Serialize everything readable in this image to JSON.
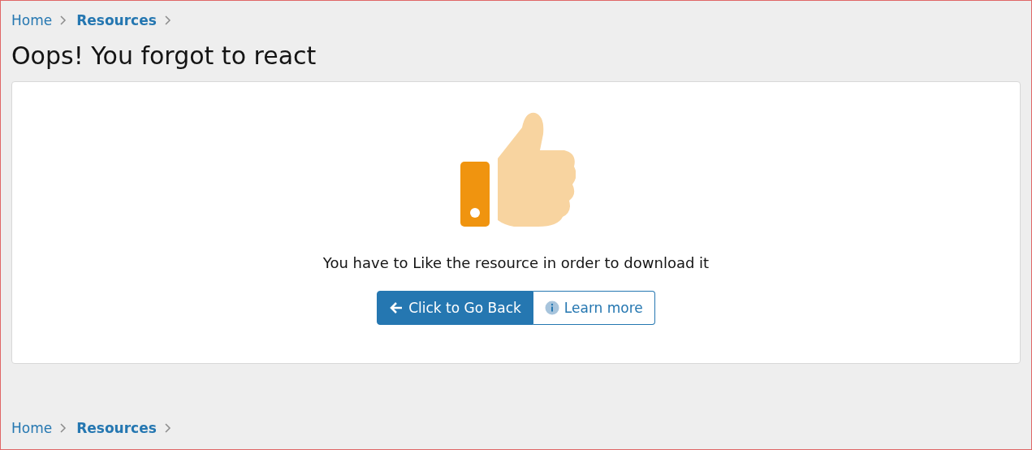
{
  "breadcrumb_top": [
    {
      "label": "Home",
      "bold": false
    },
    {
      "label": "Resources",
      "bold": true
    }
  ],
  "title": "Oops! You forgot to react",
  "notice": {
    "message": "You have to Like the resource in order to download it",
    "buttons": [
      {
        "label": "Click to Go Back",
        "kind": "primary"
      },
      {
        "label": "Learn more",
        "kind": "secondary"
      }
    ]
  },
  "breadcrumb_bottom": [
    {
      "label": "Home",
      "bold": false
    },
    {
      "label": "Resources",
      "bold": true
    }
  ]
}
